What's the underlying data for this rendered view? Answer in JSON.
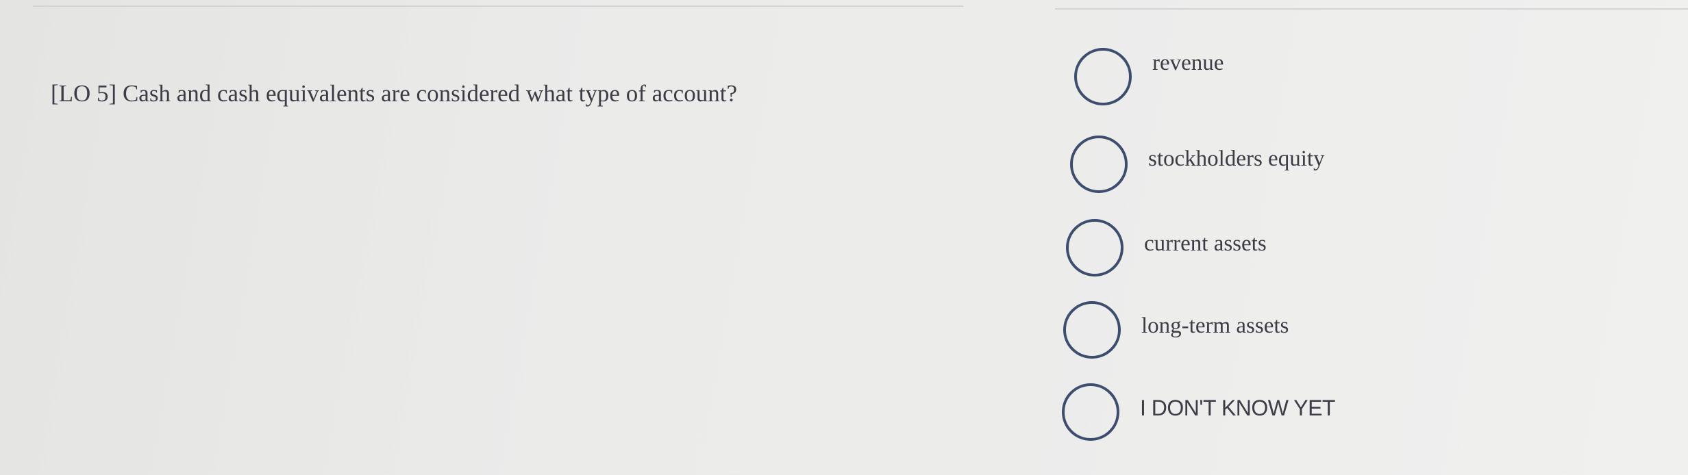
{
  "question": {
    "text": "[LO 5] Cash and cash equivalents are considered what type of account?"
  },
  "options": [
    {
      "label": "revenue",
      "selected": false
    },
    {
      "label": "stockholders equity",
      "selected": false
    },
    {
      "label": "current assets",
      "selected": false
    },
    {
      "label": "long-term assets",
      "selected": false
    },
    {
      "label": "I DON'T KNOW YET",
      "selected": false
    }
  ],
  "colors": {
    "radio_border": "#3d4d6e",
    "text": "#3b3c45",
    "background": "#ececeb"
  }
}
